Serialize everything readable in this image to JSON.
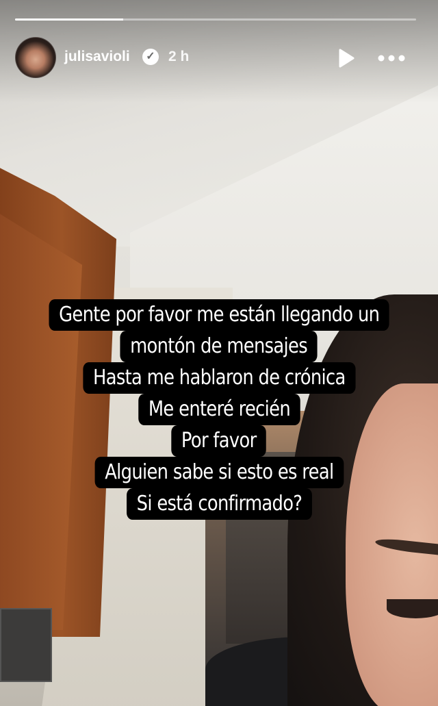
{
  "story": {
    "progress_fraction": 0.27,
    "username": "julisavioli",
    "verified_icon": "verified-check-icon",
    "timestamp": "2 h",
    "actions": {
      "play_icon": "play-icon",
      "more_icon": "more-horizontal-icon"
    },
    "caption_lines": [
      "Gente por favor me están llegando un",
      "montón de mensajes",
      "Hasta me hablaron de crónica",
      "Me enteré recién",
      "Por favor",
      "Alguien sabe si esto es real",
      "Si está confirmado?"
    ]
  },
  "colors": {
    "caption_bg": "#000000",
    "caption_text": "#ffffff",
    "header_text": "#ffffff"
  }
}
